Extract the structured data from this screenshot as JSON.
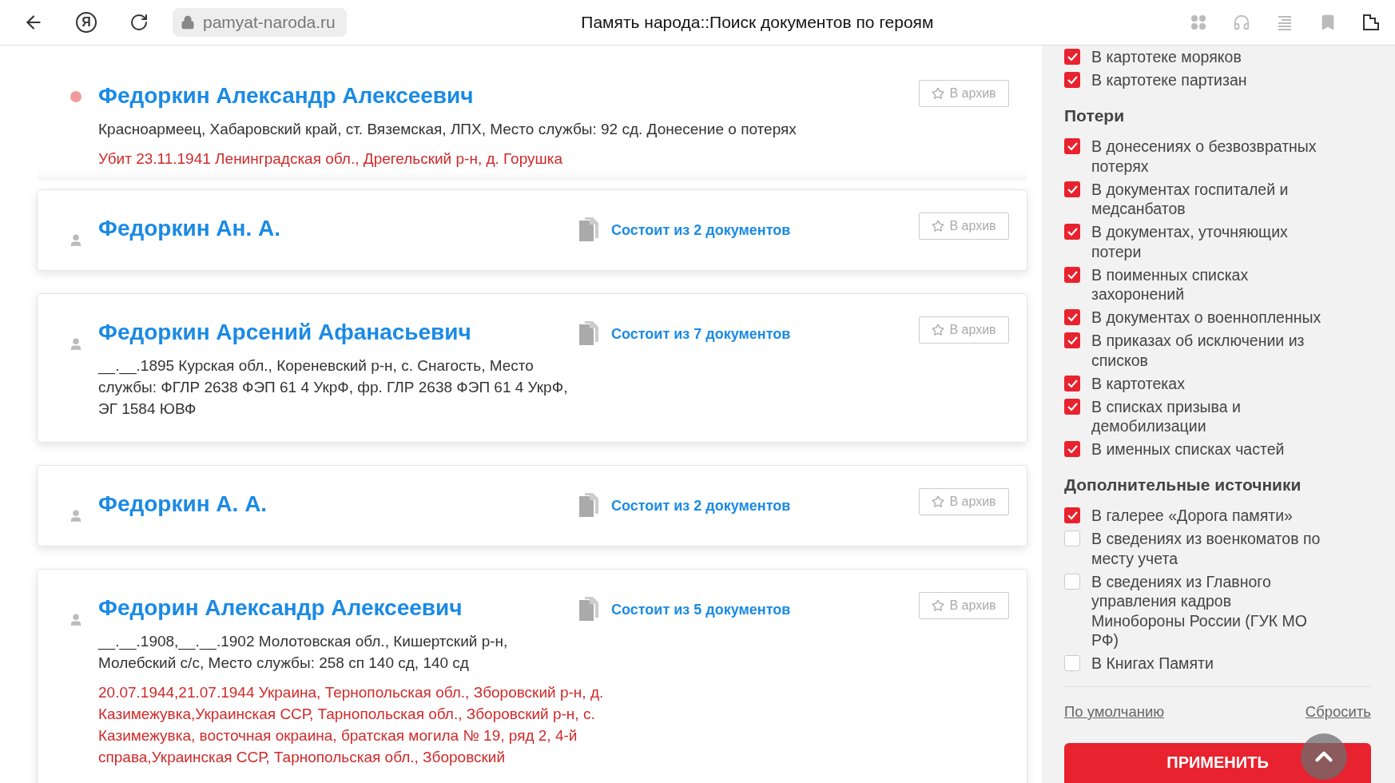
{
  "browser_bar": {
    "logo": "Я",
    "url": "pamyat-naroda.ru",
    "title": "Память народа::Поиск документов по героям"
  },
  "results": [
    {
      "kind": "highlighted",
      "name": "Федоркин Александр Алексеевич",
      "details": "Красноармеец, Хабаровский край, ст. Вяземская, ЛПХ, Место службы: 92 сд. Донесение о потерях",
      "fate": "Убит 23.11.1941 Ленинградская обл., Дрегельский р-н, д. Горушка",
      "archive": "В архив"
    },
    {
      "kind": "card",
      "name": "Федоркин Ан. А.",
      "documents": "Состоит из 2 документов",
      "archive": "В архив"
    },
    {
      "kind": "card",
      "name": "Федоркин Арсений Афанасьевич",
      "documents": "Состоит из 7 документов",
      "details": "__.__.1895 Курская обл., Кореневский р-н, с. Снагость, Место службы: ФГЛР 2638 ФЭП 61 4 УкрФ, фр. ГЛР 2638 ФЭП 61 4 УкрФ, ЭГ 1584 ЮВФ",
      "archive": "В архив"
    },
    {
      "kind": "card",
      "name": "Федоркин А. А.",
      "documents": "Состоит из 2 документов",
      "archive": "В архив"
    },
    {
      "kind": "card",
      "name": "Федорин Александр Алексеевич",
      "documents": "Состоит из 5 документов",
      "details": "__.__.1908,__.__.1902 Молотовская обл., Кишертский р-н, Молебский с/с, Место службы: 258 сп 140 сд, 140 сд",
      "fate": "20.07.1944,21.07.1944 Украина, Тернопольская обл., Зборовский р-н, д. Казимежувка,Украинская ССР, Тарнопольская обл., Зборовский р-н, с. Казимежувка, восточная окраина, братская могила № 19, ряд 2, 4-й справа,Украинская ССР, Тарнопольская обл., Зборовский",
      "archive": "В архив"
    }
  ],
  "filters": {
    "sections": [
      {
        "items": [
          {
            "label": "В картотеке моряков",
            "checked": true
          },
          {
            "label": "В картотеке партизан",
            "checked": true
          }
        ]
      },
      {
        "heading": "Потери",
        "items": [
          {
            "label": "В донесениях о безвозвратных потерях",
            "checked": true
          },
          {
            "label": "В документах госпиталей и медсанбатов",
            "checked": true
          },
          {
            "label": "В документах, уточняющих потери",
            "checked": true
          },
          {
            "label": "В поименных списках захоронений",
            "checked": true
          },
          {
            "label": "В документах о военнопленных",
            "checked": true
          },
          {
            "label": "В приказах об исключении из списков",
            "checked": true
          },
          {
            "label": "В картотеках",
            "checked": true
          },
          {
            "label": "В списках призыва и демобилизации",
            "checked": true
          },
          {
            "label": "В именных списках частей",
            "checked": true
          }
        ]
      },
      {
        "heading": "Дополнительные источники",
        "items": [
          {
            "label": "В галерее «Дорога памяти»",
            "checked": true
          },
          {
            "label": "В сведениях из военкоматов по месту учета",
            "checked": false
          },
          {
            "label": "В сведениях из Главного управления кадров Минобороны России (ГУК МО РФ)",
            "checked": false
          },
          {
            "label": "В Книгах Памяти",
            "checked": false
          }
        ]
      }
    ],
    "default_link": "По умолчанию",
    "reset_link": "Сбросить",
    "apply_button": "ПРИМЕНИТЬ"
  }
}
